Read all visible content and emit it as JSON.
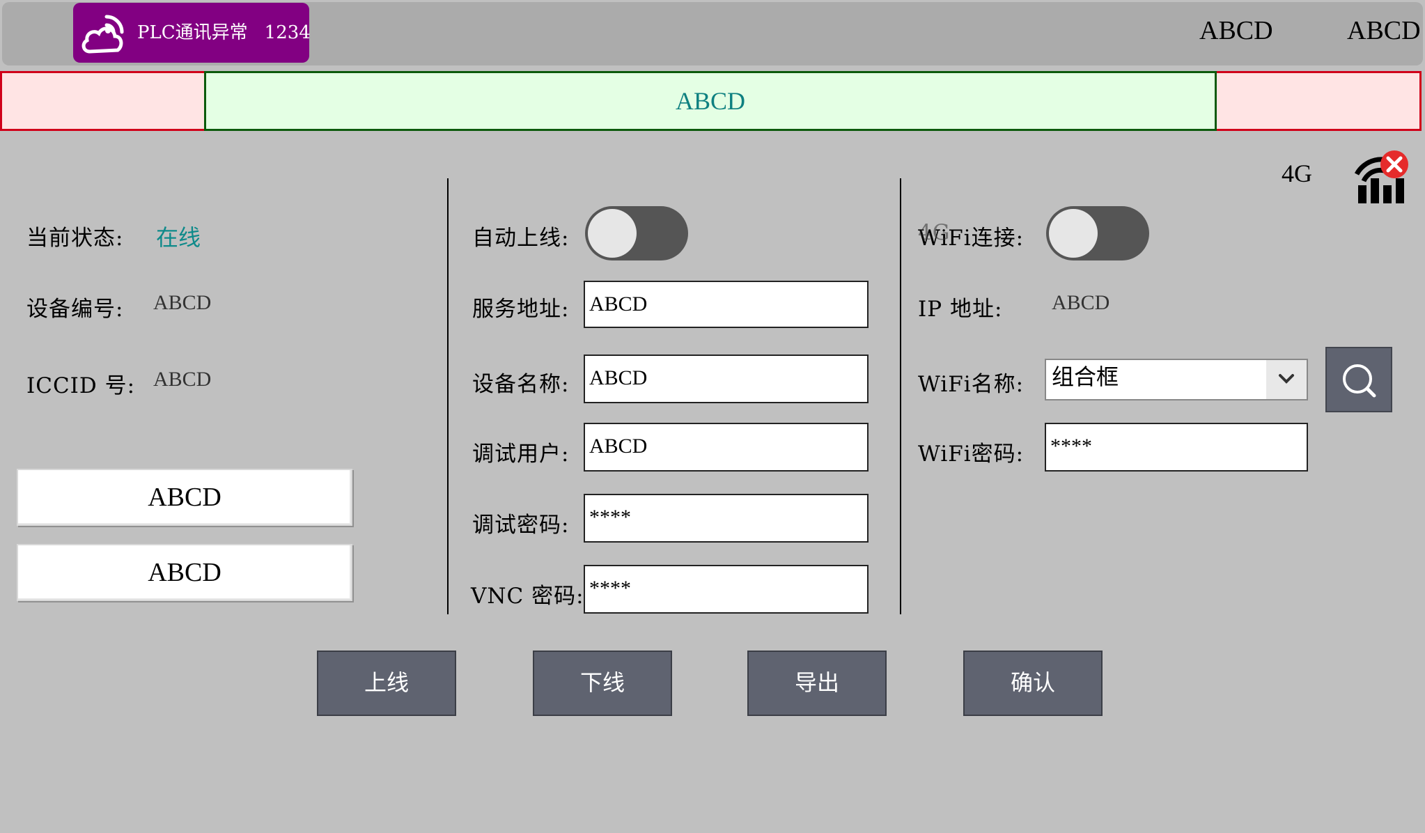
{
  "header": {
    "alarm_text": "PLC通讯异常",
    "alarm_code": "1234",
    "right_text_1": "ABCD",
    "right_text_2": "ABCD"
  },
  "banner": {
    "text": "ABCD"
  },
  "signal": {
    "label": "4G",
    "icon": "signal-disconnected-icon"
  },
  "left": {
    "status_label": "当前状态:",
    "status_value": "在线",
    "device_no_label": "设备编号:",
    "device_no_value": "ABCD",
    "iccid_label": "ICCID 号:",
    "iccid_value": "ABCD",
    "button_1": "ABCD",
    "button_2": "ABCD"
  },
  "middle": {
    "auto_online_label": "自动上线:",
    "server_label": "服务地址:",
    "server_value": "ABCD",
    "device_name_label": "设备名称:",
    "device_name_value": "ABCD",
    "debug_user_label": "调试用户:",
    "debug_user_value": "ABCD",
    "debug_pwd_label": "调试密码:",
    "debug_pwd_value": "****",
    "vnc_pwd_label": "VNC 密码:",
    "vnc_pwd_value": "****"
  },
  "right": {
    "wifi_connect_label": "WiFi连接:",
    "wifi_connect_overlay": "4G",
    "ip_label": "IP  地址:",
    "ip_value": "ABCD",
    "wifi_name_label": "WiFi名称:",
    "wifi_name_value": "组合框",
    "wifi_pwd_label": "WiFi密码:",
    "wifi_pwd_value": "****"
  },
  "actions": {
    "online": "上线",
    "offline": "下线",
    "export": "导出",
    "confirm": "确认"
  },
  "colors": {
    "background": "#c0c0c0",
    "alarm": "#820082",
    "online_text": "#0e8a8a",
    "button": "#5f6370"
  }
}
